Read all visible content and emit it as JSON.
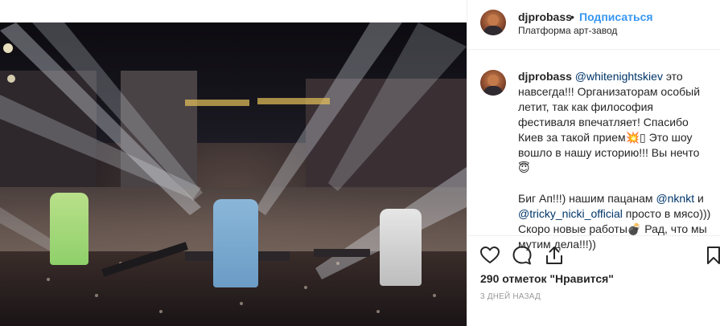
{
  "post": {
    "photo_alt": "",
    "header": {
      "username": "djprobass",
      "separator": "•",
      "follow_label": "Подписаться",
      "location": "Платформа арт-завод"
    },
    "caption": {
      "username": "djprobass",
      "mention_1": "@whitenightskiev",
      "text_1": " это навсегда!!! Организаторам особый летит, так как философия фестиваля впечатляет! Спасибо Киев за такой прием💥▯ Это шоу вошло в нашу историю!!! Вы нечто 😇\n\nБиг Ап!!!) нашим пацанам ",
      "mention_2": "@nknkt",
      "text_2": " и ",
      "mention_3": "@tricky_nicki_official",
      "text_3": " просто в мясо))) Скоро новые работы💣 Рад, что мы мутим дела!!!))"
    },
    "actions": {
      "like_icon": "heart-icon",
      "comment_icon": "comment-icon",
      "share_icon": "share-icon",
      "save_icon": "bookmark-icon"
    },
    "likes_text": "290 отметок \"Нравится\"",
    "time_text": "3 ДНЕЙ НАЗАД"
  },
  "colors": {
    "link": "#3897f0",
    "mention": "#003569",
    "text": "#262626",
    "muted": "#999999",
    "border": "#efefef"
  }
}
